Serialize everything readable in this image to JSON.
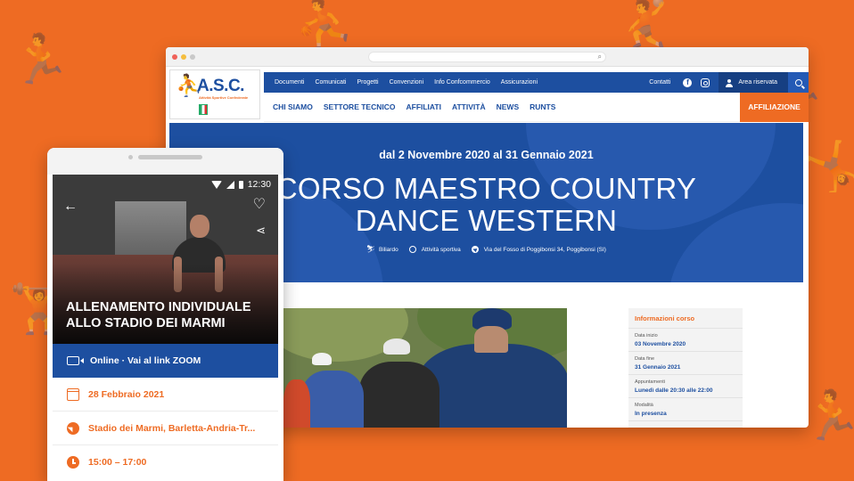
{
  "background": {
    "color": "#ee6b23"
  },
  "browser": {
    "colors": {
      "primary": "#1d4fa0",
      "accent": "#ee6b23"
    },
    "logo": {
      "name": "A.S.C.",
      "tagline": "Attività Sportive Confederate"
    },
    "top_nav": {
      "items": [
        "Documenti",
        "Comunicati",
        "Progetti",
        "Convenzioni",
        "Info Confcommercio",
        "Assicurazioni"
      ],
      "contatti": "Contatti",
      "area_riservata": "Area riservata"
    },
    "main_nav": {
      "items": [
        "CHI SIAMO",
        "SETTORE TECNICO",
        "AFFILIATI",
        "ATTIVITÀ",
        "NEWS",
        "RUNTS"
      ],
      "cta": "AFFILIAZIONE"
    },
    "hero": {
      "dates": "dal 2 Novembre 2020 al 31 Gennaio 2021",
      "title_line1": "CORSO MAESTRO COUNTRY",
      "title_line2": "DANCE WESTERN",
      "meta": {
        "sport": "Biliardo",
        "type": "Attività sportiva",
        "location": "Via del Fosso di Poggibonsi 34, Poggibonsi (SI)"
      }
    },
    "info": {
      "title": "Informazioni corso",
      "rows": [
        {
          "label": "Data inizio",
          "value": "03 Novembre 2020"
        },
        {
          "label": "Data fine",
          "value": "31 Gennaio 2021"
        },
        {
          "label": "Appuntamenti",
          "value": "Lunedì dalle 20:30 alle 22:00"
        },
        {
          "label": "Modalità",
          "value": "In presenza"
        }
      ]
    }
  },
  "phone": {
    "status_time": "12:30",
    "title": "ALLENAMENTO INDIVIDUALE ALLO STADIO DEI MARMI",
    "online": "Online · Vai al link ZOOM",
    "date": "28 Febbraio 2021",
    "place": "Stadio dei Marmi, Barletta-Andria-Tr...",
    "time": "15:00 – 17:00"
  }
}
